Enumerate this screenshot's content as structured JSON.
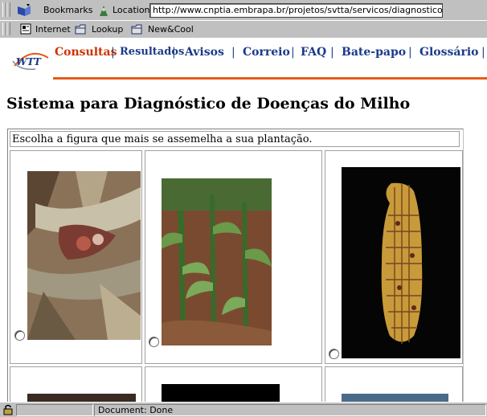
{
  "toolbar": {
    "bookmarks_label": "Bookmarks",
    "location_label": "Location:",
    "url": "http://www.cnptia.embrapa.br/projetos/svtta/servicos/diagnostico/milho/"
  },
  "personal_toolbar": {
    "items": [
      "Internet",
      "Lookup",
      "New&Cool"
    ]
  },
  "site": {
    "logo_text": "WTT",
    "nav": [
      "Consultas",
      "Resultados",
      "Avisos",
      "Correio",
      "FAQ",
      "Bate-papo",
      "Glossário"
    ],
    "nav_separator": "|",
    "colors": {
      "accent": "#e65c1a",
      "link": "#1a3a8a",
      "current": "#cc3300"
    }
  },
  "page": {
    "title": "Sistema para Diagnóstico de Doenças do Milho",
    "instruction": "Escolha a figura que mais se assemelha a sua plantação."
  },
  "status_bar": {
    "text": "Document: Done"
  }
}
